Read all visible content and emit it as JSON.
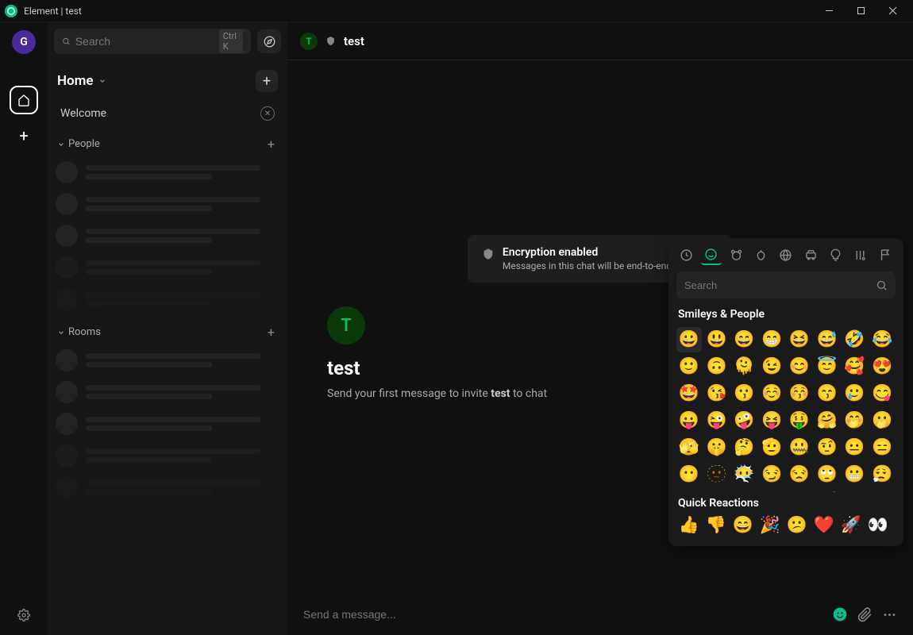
{
  "titlebar": {
    "title": "Element | test"
  },
  "rail": {
    "avatar_letter": "G"
  },
  "sidebar": {
    "search_placeholder": "Search",
    "search_hint": "Ctrl K",
    "home_label": "Home",
    "welcome_label": "Welcome",
    "people_label": "People",
    "rooms_label": "Rooms"
  },
  "room": {
    "header_letter": "T",
    "name": "test",
    "encryption_title": "Encryption enabled",
    "encryption_sub": "Messages in this chat will be end-to-end encrypted.",
    "invite_letter": "T",
    "invite_name": "test",
    "invite_prefix": "Send your first message to invite ",
    "invite_bold": "test",
    "invite_suffix": " to chat",
    "composer_placeholder": "Send a message..."
  },
  "emoji": {
    "search_placeholder": "Search",
    "section_label": "Smileys & People",
    "quick_label": "Quick Reactions",
    "grid": [
      "😀",
      "😃",
      "😄",
      "😁",
      "😆",
      "😅",
      "🤣",
      "😂",
      "🙂",
      "🙃",
      "🫠",
      "😉",
      "😊",
      "😇",
      "🥰",
      "😍",
      "🤩",
      "😘",
      "😗",
      "☺️",
      "😚",
      "😙",
      "🥲",
      "😋",
      "😛",
      "😜",
      "🤪",
      "😝",
      "🤑",
      "🤗",
      "🤭",
      "🫢",
      "🫣",
      "🤫",
      "🤔",
      "🫡",
      "🤐",
      "🤨",
      "😐",
      "😑",
      "😶",
      "🫥",
      "😶‍🌫️",
      "😏",
      "😒",
      "🙄",
      "😬",
      "😮‍💨",
      "🤥",
      "😌",
      "😔",
      "😪",
      "🤤",
      "😴",
      "😷",
      "🤒"
    ],
    "quick": [
      "👍",
      "👎",
      "😄",
      "🎉",
      "😕",
      "❤️",
      "🚀",
      "👀"
    ]
  }
}
